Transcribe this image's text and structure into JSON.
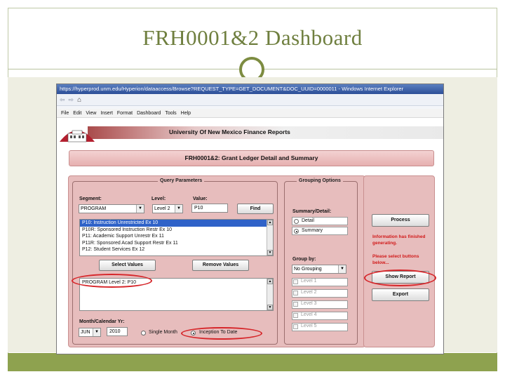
{
  "slide": {
    "title": "FRH0001&2 Dashboard"
  },
  "browser": {
    "title": "https://hyperprod.unm.edu/Hyperion/dataaccess/Browse?REQUEST_TYPE=GET_DOCUMENT&DOC_UUID=0000011 - Windows Internet Explorer",
    "nav": {
      "back": "⇦",
      "forward": "⇨",
      "home": "⌂"
    },
    "menu": [
      "File",
      "Edit",
      "View",
      "Insert",
      "Format",
      "Dashboard",
      "Tools",
      "Help"
    ]
  },
  "page": {
    "banner_title": "University Of New Mexico Finance Reports",
    "report_title": "FRH0001&2: Grant Ledger Detail and Summary"
  },
  "query": {
    "legend": "Query Parameters",
    "segment_label": "Segment:",
    "segment_value": "PROGRAM",
    "level_label": "Level:",
    "level_value": "Level 2",
    "value_label": "Value:",
    "value_value": "P10",
    "find_label": "Find",
    "list_items": [
      "P10: Instruction Unrestricted Ex 10",
      "P10R: Sponsored Instruction Restr Ex 10",
      "P11: Academic Support Unrestr Ex 11",
      "P11R: Sponsored Acad Support Restr Ex 11",
      "P12: Student Services Ex 12"
    ],
    "select_values_label": "Select Values",
    "remove_values_label": "Remove Values",
    "selected_item": "PROGRAM Level 2: P10",
    "month_label": "Month/Calendar Yr:",
    "month_value": "JUN",
    "year_value": "2010",
    "single_month_label": "Single Month",
    "inception_label": "Inception To Date"
  },
  "grouping": {
    "legend": "Grouping Options",
    "summary_detail_label": "Summary/Detail:",
    "detail_label": "Detail",
    "summary_label": "Summary",
    "group_by_label": "Group by:",
    "group_by_value": "No Grouping",
    "levels": [
      "Level 1",
      "Level 2",
      "Level 3",
      "Level 4",
      "Level 5"
    ]
  },
  "actions": {
    "process_label": "Process",
    "msg1": "Information has finished generating.",
    "msg2": "Please select buttons below...",
    "show_report_label": "Show Report",
    "export_label": "Export"
  },
  "colors": {
    "accent_green": "#8ea24f",
    "title_green": "#6f7f3f",
    "panel_pink": "#e7bdbd",
    "annotation_red": "#d6262a"
  }
}
